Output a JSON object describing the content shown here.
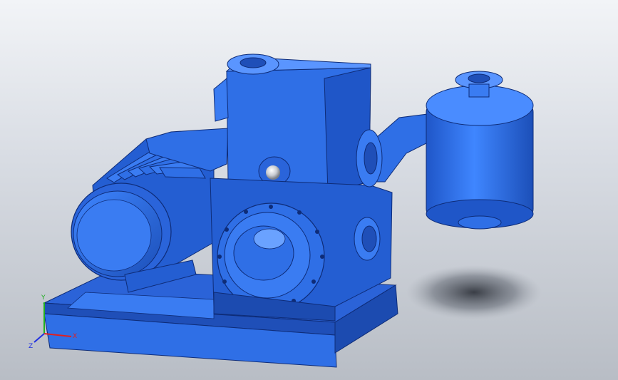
{
  "viewport": {
    "background_top": "#f2f4f7",
    "background_bottom": "#b8bdc5"
  },
  "model": {
    "part_color": "#2f6fe6",
    "part_shadow": "#1f4fb8",
    "part_highlight": "#6aa2ff",
    "edge_color": "#0e2c78",
    "sight_glass_color": "#d9dde2"
  },
  "triad": {
    "x_label": "X",
    "y_label": "Y",
    "z_label": "Z",
    "x_color": "#e02020",
    "y_color": "#20b020",
    "z_color": "#2030e0"
  }
}
